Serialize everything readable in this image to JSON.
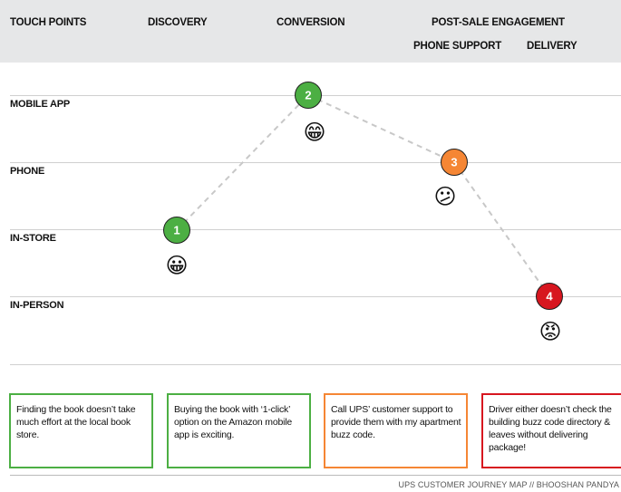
{
  "header": {
    "columns": {
      "touch_points": "TOUCH POINTS",
      "discovery": "DISCOVERY",
      "conversion": "CONVERSION",
      "post_sale": "POST-SALE ENGAGEMENT",
      "phone_support": "PHONE SUPPORT",
      "delivery": "DELIVERY"
    }
  },
  "rows": [
    "MOBILE APP",
    "PHONE",
    "IN-STORE",
    "IN-PERSON"
  ],
  "steps": [
    {
      "number": "1",
      "stage": "DISCOVERY",
      "touch_point": "IN-STORE",
      "emoji": "😀",
      "sentiment": "happy",
      "color": "#4caf43",
      "note": "Finding the book doesn’t take much effort at the local book store."
    },
    {
      "number": "2",
      "stage": "CONVERSION",
      "touch_point": "MOBILE APP",
      "emoji": "😁",
      "sentiment": "very-happy",
      "color": "#4caf43",
      "note": "Buying the book with ‘1-click’ option on the Amazon mobile app is exciting."
    },
    {
      "number": "3",
      "stage": "PHONE SUPPORT",
      "touch_point": "PHONE",
      "emoji": "😕",
      "sentiment": "confused",
      "color": "#f58634",
      "note": "Call UPS’ customer support to provide them with my apartment buzz code."
    },
    {
      "number": "4",
      "stage": "DELIVERY",
      "touch_point": "IN-PERSON",
      "emoji": "😡",
      "sentiment": "angry",
      "color": "#d7161f",
      "note": "Driver either doesn’t check the building buzz code directory & leaves without delivering package!"
    }
  ],
  "colors": {
    "positive": "#4caf43",
    "neutral": "#f58634",
    "negative": "#d7161f",
    "header_bg": "#e6e7e8",
    "connector": "#c8c8c8"
  },
  "footer": "UPS CUSTOMER JOURNEY MAP // BHOOSHAN PANDYA"
}
